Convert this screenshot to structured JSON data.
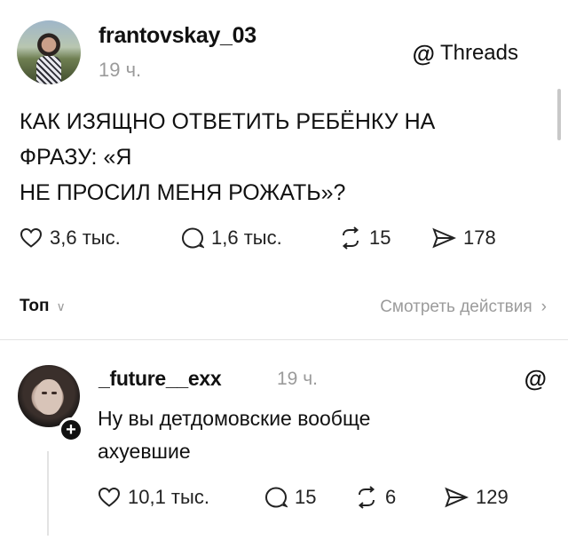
{
  "post": {
    "username": "frantovskay_03",
    "time": "19 ч.",
    "platform_glyph": "@",
    "platform_label": "Threads",
    "text": "КАК ИЗЯЩНО ОТВЕТИТЬ РЕБЁНКУ НА\nФРАЗУ: «Я\nНЕ ПРОСИЛ МЕНЯ РОЖАТЬ»?",
    "likes": "3,6 тыс.",
    "comments": "1,6 тыс.",
    "reposts": "15",
    "shares": "178"
  },
  "sort": {
    "label": "Топ",
    "chevron": "∨",
    "view_actions": "Смотреть действия",
    "view_actions_chevron": "›"
  },
  "reply": {
    "username": "_future__exx",
    "time": "19 ч.",
    "platform_glyph": "@",
    "follow_glyph": "+",
    "text": "Ну вы детдомовские вообще\nахуевшие",
    "likes": "10,1 тыс.",
    "comments": "15",
    "reposts": "6",
    "shares": "129"
  },
  "icons": {
    "like": "heart-icon",
    "comment": "comment-icon",
    "repost": "repost-icon",
    "share": "send-icon",
    "platform": "threads-logo-icon"
  },
  "colors": {
    "text": "#111111",
    "muted": "#9b9b9b",
    "divider": "#e3e3e3",
    "background": "#ffffff"
  }
}
